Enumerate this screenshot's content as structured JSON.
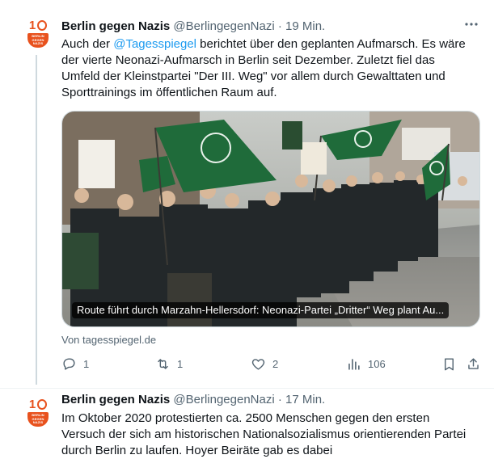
{
  "tweets": [
    {
      "author_name": "Berlin gegen Nazis",
      "handle": "@BerlingegenNazi",
      "separator": "·",
      "time": "19 Min.",
      "text_before": "Auch der ",
      "mention": "@Tagesspiegel",
      "text_after": " berichtet über den geplanten Aufmarsch. Es wäre der vierte Neonazi-Aufmarsch in Berlin seit Dezember. Zuletzt fiel das Umfeld der Kleinstpartei \"Der III. Weg\" vor allem durch Gewalttaten und Sporttrainings im öffentlichen Raum auf.",
      "link_card_title": "Route führt durch Marzahn-Hellersdorf: Neonazi-Partei „Dritter“ Weg plant Au...",
      "link_source": "Von tagesspiegel.de",
      "stats": {
        "replies": "1",
        "retweets": "1",
        "likes": "2",
        "views": "106"
      }
    },
    {
      "author_name": "Berlin gegen Nazis",
      "handle": "@BerlingegenNazi",
      "separator": "·",
      "time": "17 Min.",
      "text": "Im Oktober 2020 protestierten ca. 2500 Menschen gegen den ersten Versuch der sich am historischen Nationalsozialismus orientierenden Partei durch Berlin zu laufen. Hoyer Beiräte gab es dabei"
    }
  ],
  "avatar": {
    "number_one": "1",
    "lines": [
      "BERLIN",
      "GEGEN",
      "NAZIS"
    ]
  },
  "more_icon": "more-horizontal-icon",
  "colors": {
    "accent": "#1d9bf0",
    "secondary_text": "#536471",
    "avatar_orange": "#e8521e",
    "flag_green": "#1f6b3a"
  }
}
